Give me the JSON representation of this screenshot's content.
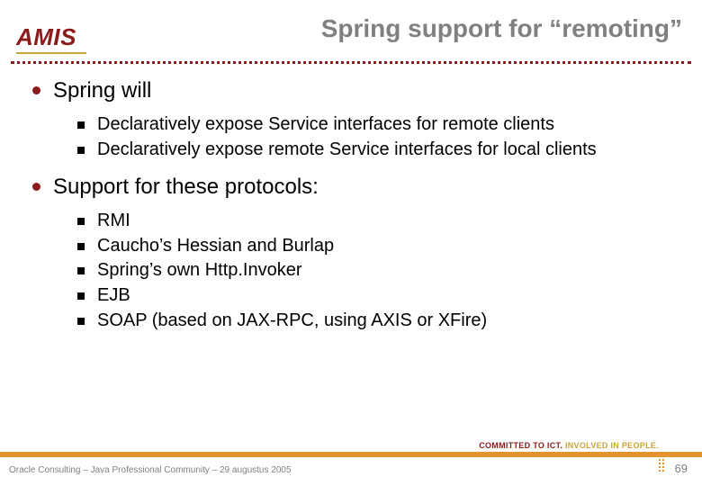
{
  "logo_text": "AMIS",
  "title": "Spring support for “remoting”",
  "bullets": [
    {
      "text": "Spring will",
      "sub": [
        "Declaratively expose Service interfaces for remote clients",
        "Declaratively expose remote Service interfaces for local clients"
      ]
    },
    {
      "text": "Support for these protocols:",
      "sub": [
        "RMI",
        "Caucho’s Hessian and Burlap",
        "Spring’s own Http.Invoker",
        "EJB",
        "SOAP (based on JAX-RPC, using AXIS or XFire)"
      ]
    }
  ],
  "tagline_part1": "COMMITTED TO ICT.",
  "tagline_part2": " INVOLVED IN PEOPLE.",
  "footer_info": "Oracle Consulting – Java Professional Community – 29 augustus 2005",
  "page_number": "69"
}
